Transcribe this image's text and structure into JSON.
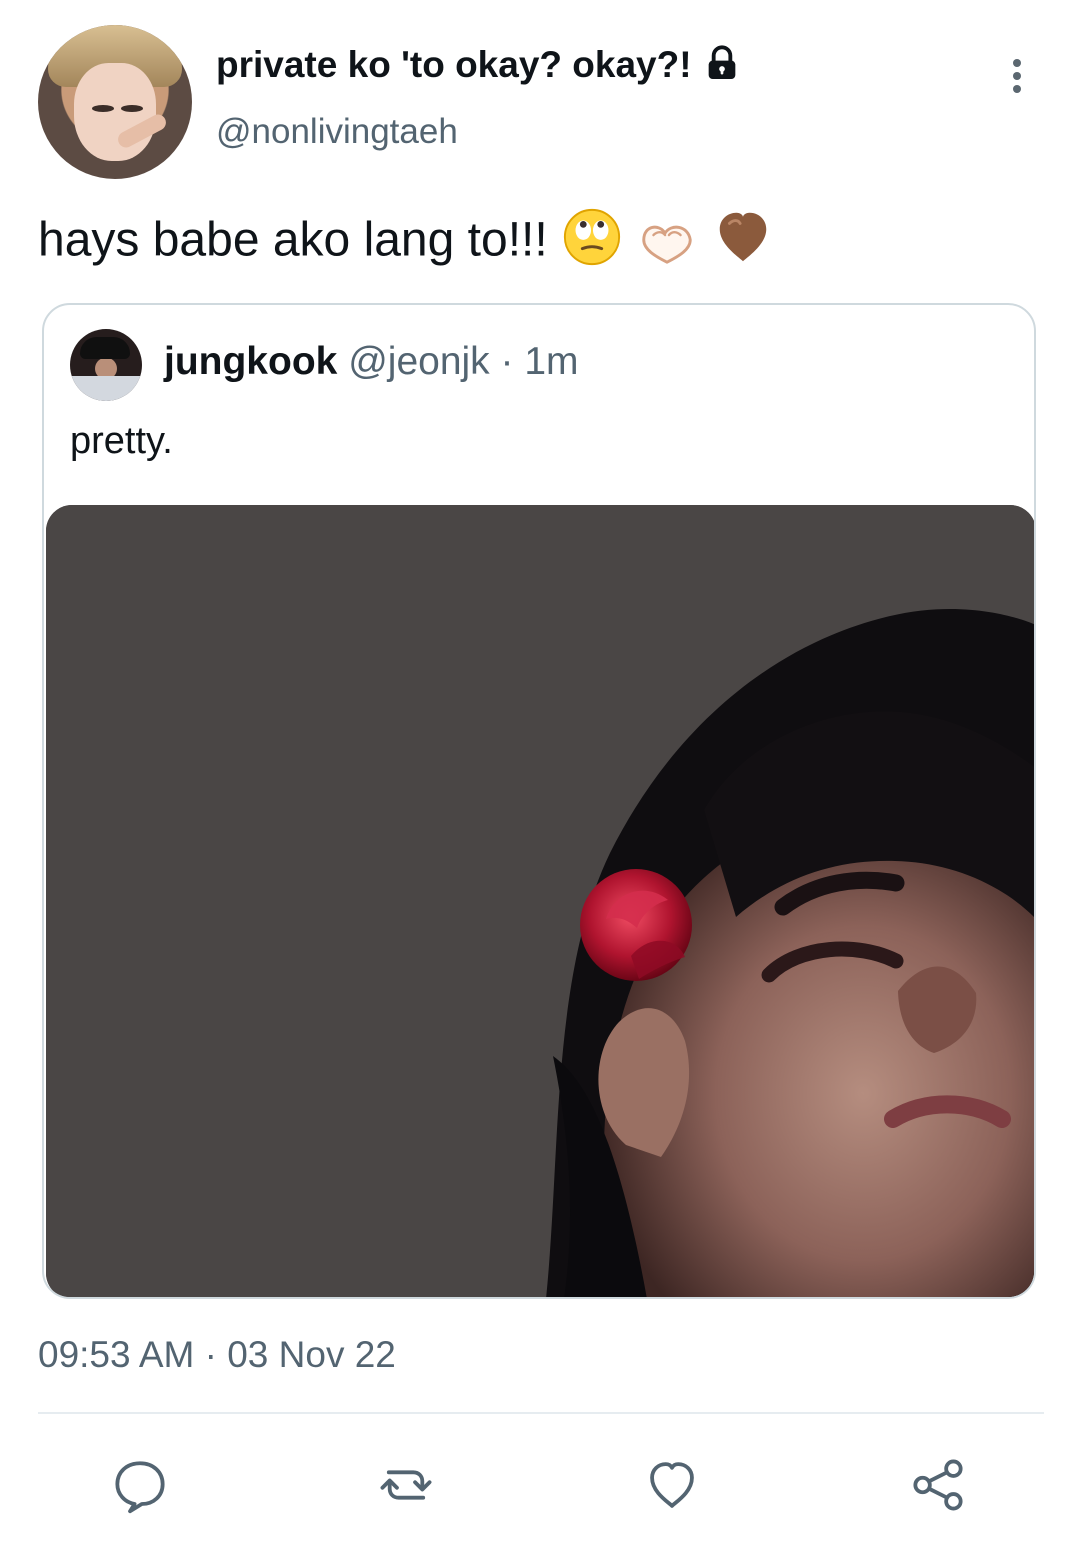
{
  "tweet": {
    "author": {
      "display_name": "private ko 'to okay? okay?!",
      "handle": "@nonlivingtaeh"
    },
    "text": "hays babe ako lang to!!!",
    "emojis": [
      "eye-roll-emoji",
      "heart-hands-emoji",
      "brown-heart-emoji"
    ],
    "timestamp": "09:53 AM · 03 Nov 22",
    "icons": {
      "lock": "lock-icon",
      "more": "more-vertical-icon",
      "reply": "reply-icon",
      "retweet": "retweet-icon",
      "like": "like-icon",
      "share": "share-icon"
    }
  },
  "quote": {
    "author": {
      "display_name": "jungkook",
      "handle": "@jeonjk",
      "relative_time": "1m"
    },
    "separator": " · ",
    "text": "pretty."
  },
  "colors": {
    "primary_text": "#0f1419",
    "secondary_text": "#536471",
    "border": "#cfd9de",
    "divider": "#e6ecf0",
    "icon": "#536471"
  }
}
